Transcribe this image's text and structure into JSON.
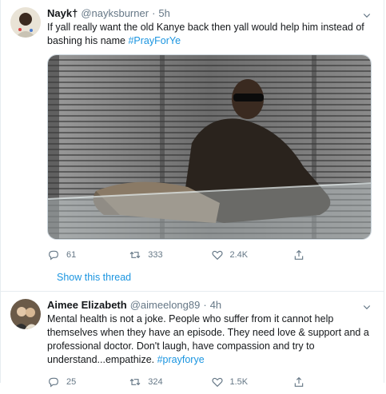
{
  "tweets": [
    {
      "name": "Nayk†",
      "handle": "@nayksburner",
      "dot": "·",
      "time": "5h",
      "text": "If yall really want the old Kanye back then yall would help him instead of bashing his name",
      "hashtag": "#PrayForYe",
      "replies": "61",
      "retweets": "333",
      "likes": "2.4K"
    },
    {
      "name": "Aimee Elizabeth",
      "handle": "@aimeelong89",
      "dot": "·",
      "time": "4h",
      "text": "Mental health is not a joke. People who suffer from it cannot help themselves when they have an episode. They need love & support and a professional doctor. Don't laugh, have compassion and try to understand...empathize.",
      "hashtag": "#prayforye",
      "replies": "25",
      "retweets": "324",
      "likes": "1.5K"
    }
  ],
  "show_thread": "Show this thread",
  "colors": {
    "link": "#1b95e0",
    "secondary": "#657786",
    "border": "#e6ecf0"
  },
  "icons": [
    "chevron-down-icon",
    "reply-icon",
    "retweet-icon",
    "like-icon",
    "share-icon"
  ]
}
